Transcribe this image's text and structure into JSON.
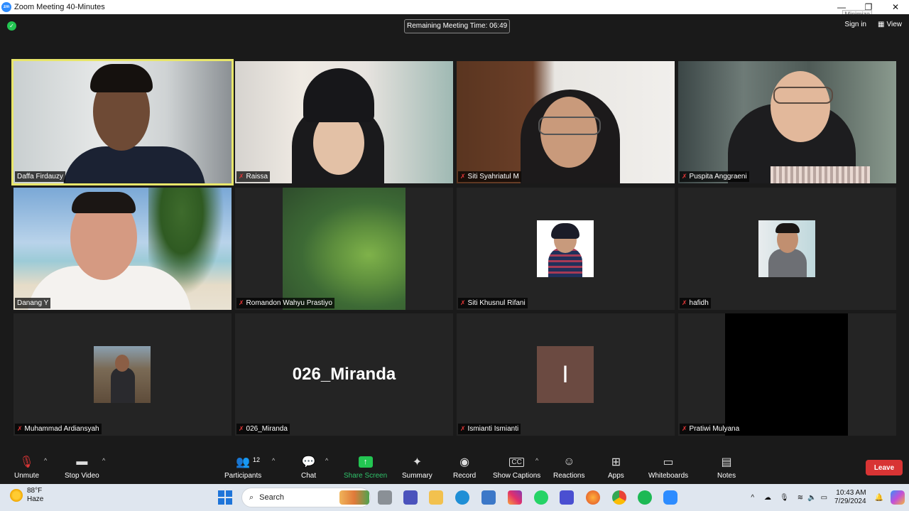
{
  "window": {
    "title": "Zoom Meeting 40-Minutes",
    "tooltip": "Minimize",
    "minimize": "—",
    "restore": "❐",
    "close": "✕"
  },
  "topbar": {
    "remaining": "Remaining Meeting Time: 06:49",
    "signin": "Sign in",
    "view": "View"
  },
  "participants": [
    {
      "name": "Daffa Firdauzy",
      "muted": false,
      "active": true
    },
    {
      "name": "Raissa",
      "muted": true
    },
    {
      "name": "Siti Syahriatul M",
      "muted": true
    },
    {
      "name": "Puspita Anggraeni",
      "muted": true
    },
    {
      "name": "Danang Y",
      "muted": false
    },
    {
      "name": "Romandon Wahyu Prastiyo",
      "muted": true
    },
    {
      "name": "Siti Khusnul Rifani",
      "muted": true
    },
    {
      "name": "hafidh",
      "muted": true
    },
    {
      "name": "Muhammad Ardiansyah",
      "muted": true
    },
    {
      "name": "026_Miranda",
      "muted": true,
      "display_name": "026_Miranda"
    },
    {
      "name": "Ismianti Ismianti",
      "muted": true,
      "initial": "I"
    },
    {
      "name": "Pratiwi Mulyana",
      "muted": true
    }
  ],
  "toolbar": {
    "unmute": "Unmute",
    "stop_video": "Stop Video",
    "participants": "Participants",
    "participants_count": "12",
    "chat": "Chat",
    "share_screen": "Share Screen",
    "summary": "Summary",
    "record": "Record",
    "captions": "Show Captions",
    "reactions": "Reactions",
    "apps": "Apps",
    "whiteboards": "Whiteboards",
    "notes": "Notes",
    "leave": "Leave",
    "accent": "#23c552",
    "leave_color": "#d83434"
  },
  "taskbar": {
    "temp": "88°F",
    "weather": "Haze",
    "search": "Search",
    "time": "10:43 AM",
    "date": "7/29/2024"
  },
  "icons": {
    "mic_off": "✗",
    "search": "⌕"
  }
}
